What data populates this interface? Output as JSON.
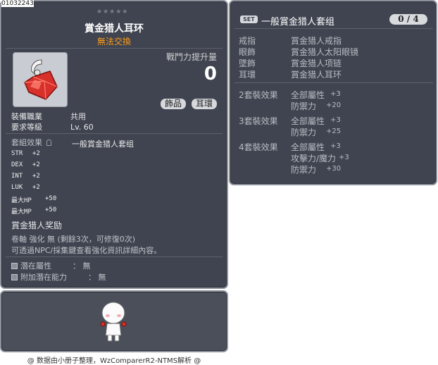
{
  "item_id": "01032243",
  "tooltip": {
    "stars": "★★★★★",
    "title": "賞金猎人耳环",
    "trade": "無法交換",
    "power_label": "戰鬥力提升量",
    "power_value": "0",
    "tags": [
      "飾品",
      "耳環"
    ],
    "job_label": "裝備職業",
    "job_value": "共用",
    "level_label": "要求等級",
    "level_value": "Lv. 60",
    "set_effect_label": "套組效果",
    "set_name": "一般賞金猎人套组",
    "stats": [
      {
        "name": "STR",
        "value": "+2"
      },
      {
        "name": "DEX",
        "value": "+2"
      },
      {
        "name": "INT",
        "value": "+2"
      },
      {
        "name": "LUK",
        "value": "+2"
      },
      {
        "name": "最大HP",
        "value": "+50"
      },
      {
        "name": "最大MP",
        "value": "+50"
      }
    ],
    "reward": "賞金猎人奖励",
    "scroll_line": "卷軸 強化 無 (剩餘3次，可修復0次)",
    "enhance_line": "可透過NPC/採集鍵查看強化資訊詳細內容。",
    "potential_label": "潛在屬性",
    "potential_value": "： 無",
    "bonus_label": "附加潛在能力",
    "bonus_value": "： 無"
  },
  "set_panel": {
    "badge": "SET",
    "title": "一般賞金猎人套组",
    "count": "0 / 4",
    "parts": [
      {
        "slot": "戒指",
        "item": "賞金猎人戒指"
      },
      {
        "slot": "眼飾",
        "item": "賞金猎人太阳眼镜"
      },
      {
        "slot": "墜飾",
        "item": "賞金猎人项链"
      },
      {
        "slot": "耳環",
        "item": "賞金猎人耳环"
      }
    ],
    "effects": [
      {
        "label": "2套裝效果",
        "lines": [
          {
            "k": "全部屬性",
            "v": "+3"
          },
          {
            "k": "防禦力",
            "v": "+20"
          }
        ]
      },
      {
        "label": "3套裝效果",
        "lines": [
          {
            "k": "全部屬性",
            "v": "+3"
          },
          {
            "k": "防禦力",
            "v": "+25"
          }
        ]
      },
      {
        "label": "4套裝效果",
        "lines": [
          {
            "k": "全部屬性",
            "v": "+3"
          },
          {
            "k": "攻擊力/魔力",
            "v": "+3"
          },
          {
            "k": "防禦力",
            "v": "+30"
          }
        ]
      }
    ]
  },
  "footer": "@ 数据由小册子整理，WzComparerR2-NTMS解析 @",
  "colors": {
    "panel_bg": "#3f4450",
    "panel_border": "#8d929c",
    "trade_orange": "#ff9c1a"
  }
}
